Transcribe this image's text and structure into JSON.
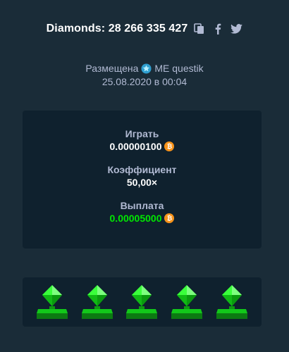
{
  "header": {
    "title": "Diamonds: 28 266 335 427"
  },
  "meta": {
    "placed_label": "Размещена",
    "username": "ME questik",
    "datetime": "25.08.2020 в 00:04"
  },
  "bet": {
    "play_label": "Играть",
    "play_amount": "0.00000100",
    "multiplier_label": "Коэффициент",
    "multiplier_value": "50,00×",
    "payout_label": "Выплата",
    "payout_amount": "0.00005000",
    "currency_symbol": "₿"
  },
  "result": {
    "gems": [
      "green-diamond-icon",
      "green-diamond-icon",
      "green-diamond-icon",
      "green-diamond-icon",
      "green-diamond-icon"
    ]
  },
  "colors": {
    "background": "#1a2c38",
    "panel": "#0f212e",
    "muted_text": "#b1bad3",
    "payout_green": "#00e701",
    "coin_orange": "#f7931a",
    "gem_green": "#1fff20"
  }
}
